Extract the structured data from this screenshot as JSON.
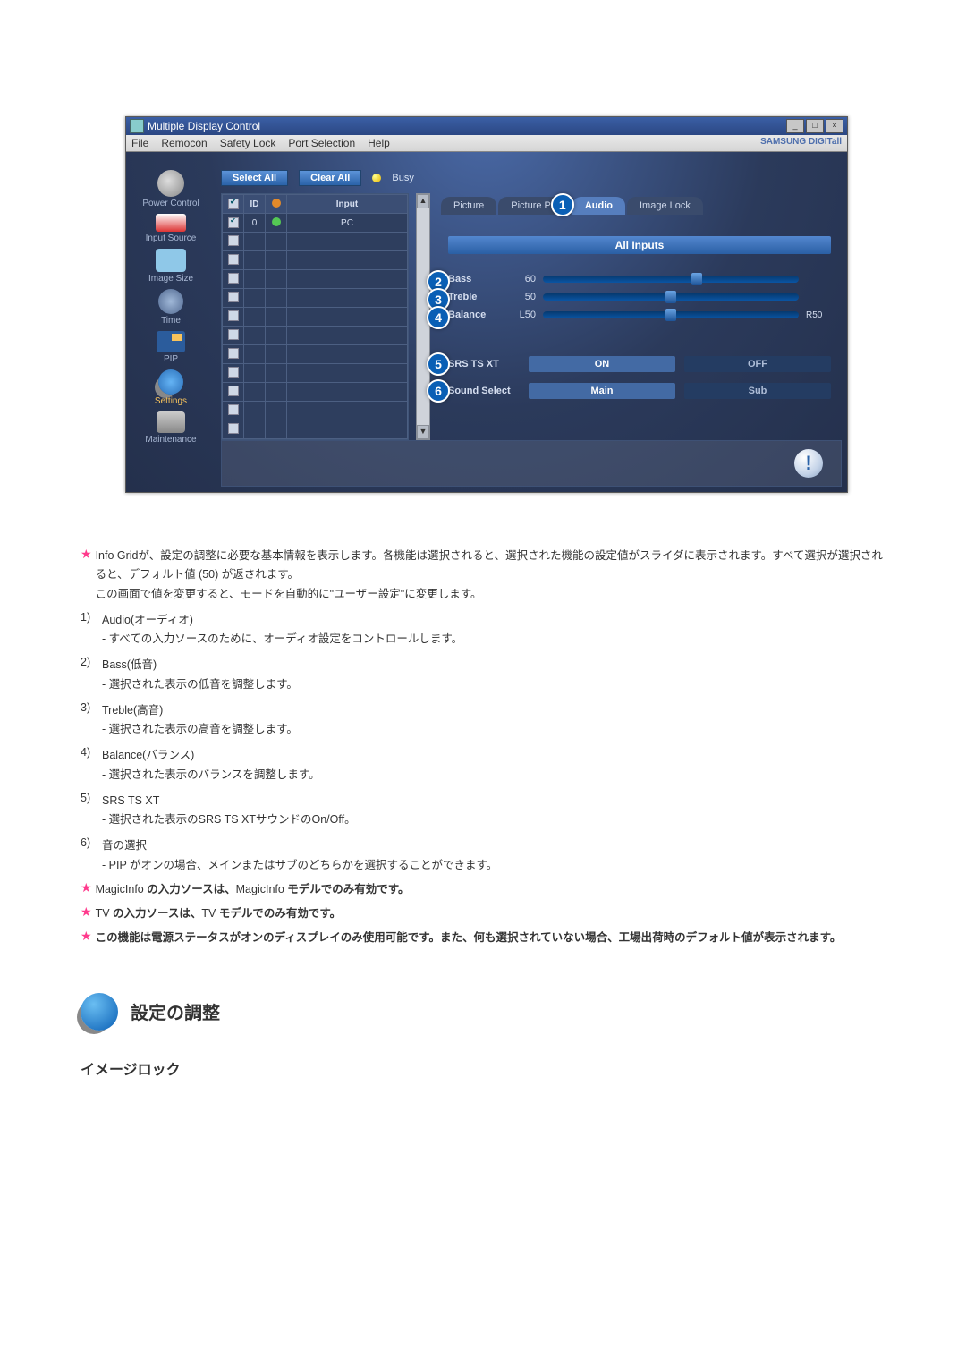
{
  "window": {
    "title": "Multiple Display Control",
    "menus": [
      "File",
      "Remocon",
      "Safety Lock",
      "Port Selection",
      "Help"
    ],
    "brand": "SAMSUNG DIGITall"
  },
  "sidebar": {
    "items": [
      {
        "label": "Power Control"
      },
      {
        "label": "Input Source"
      },
      {
        "label": "Image Size"
      },
      {
        "label": "Time"
      },
      {
        "label": "PIP"
      },
      {
        "label": "Settings"
      },
      {
        "label": "Maintenance"
      }
    ]
  },
  "toolbar": {
    "select_all": "Select All",
    "clear_all": "Clear All",
    "busy": "Busy"
  },
  "grid": {
    "headers": {
      "chk": "",
      "id": "ID",
      "status": "",
      "input": "Input"
    },
    "rows": [
      {
        "id": "0",
        "input": "PC"
      }
    ]
  },
  "tabs": {
    "picture": "Picture",
    "picture_pc": "Picture PC",
    "audio": "Audio",
    "image_lock": "Image Lock"
  },
  "callouts": {
    "tab_audio": "1",
    "bass": "2",
    "treble": "3",
    "balance": "4",
    "srs": "5",
    "sound_select": "6"
  },
  "panel": {
    "all_inputs": "All Inputs",
    "bass": {
      "label": "Bass",
      "value": "60"
    },
    "treble": {
      "label": "Treble",
      "value": "50"
    },
    "balance": {
      "label": "Balance",
      "left": "L50",
      "right": "R50"
    },
    "srs": {
      "label": "SRS TS XT",
      "on": "ON",
      "off": "OFF"
    },
    "sound_select": {
      "label": "Sound Select",
      "main": "Main",
      "sub": "Sub"
    }
  },
  "desc": {
    "info_grid": "Info Gridが、設定の調整に必要な基本情報を表示します。各機能は選択されると、選択された機能の設定値がスライダに表示されます。すべて選択が選択されると、デフォルト値 (50) が返されます。\nこの画面で値を変更すると、モードを自動的に\"ユーザー設定\"に変更します。",
    "items": [
      {
        "n": "1)",
        "title": "Audio(オーディオ)",
        "body": "- すべての入力ソースのために、オーディオ設定をコントロールします。"
      },
      {
        "n": "2)",
        "title": "Bass(低音)",
        "body": "- 選択された表示の低音を調整します。"
      },
      {
        "n": "3)",
        "title": "Treble(高音)",
        "body": "- 選択された表示の高音を調整します。"
      },
      {
        "n": "4)",
        "title": "Balance(バランス)",
        "body": "- 選択された表示のバランスを調整します。"
      },
      {
        "n": "5)",
        "title": "SRS TS XT",
        "body": "- 選択された表示のSRS TS XTサウンドのOn/Off。"
      },
      {
        "n": "6)",
        "title": "音の選択",
        "body": "- PIP がオンの場合、メインまたはサブのどちらかを選択することができます。"
      }
    ],
    "star1_a": "MagicInfo ",
    "star1_b": "の入力ソースは、",
    "star1_c": "MagicInfo ",
    "star1_d": "モデルでのみ有効です。",
    "star2_a": "TV ",
    "star2_b": "の入力ソースは、",
    "star2_c": "TV ",
    "star2_d": "モデルでのみ有効です。",
    "star3": "この機能は電源ステータスがオンのディスプレイのみ使用可能です。また、何も選択されていない場合、工場出荷時のデフォルト値が表示されます。"
  },
  "section": {
    "title": "設定の調整",
    "sub": "イメージロック"
  }
}
